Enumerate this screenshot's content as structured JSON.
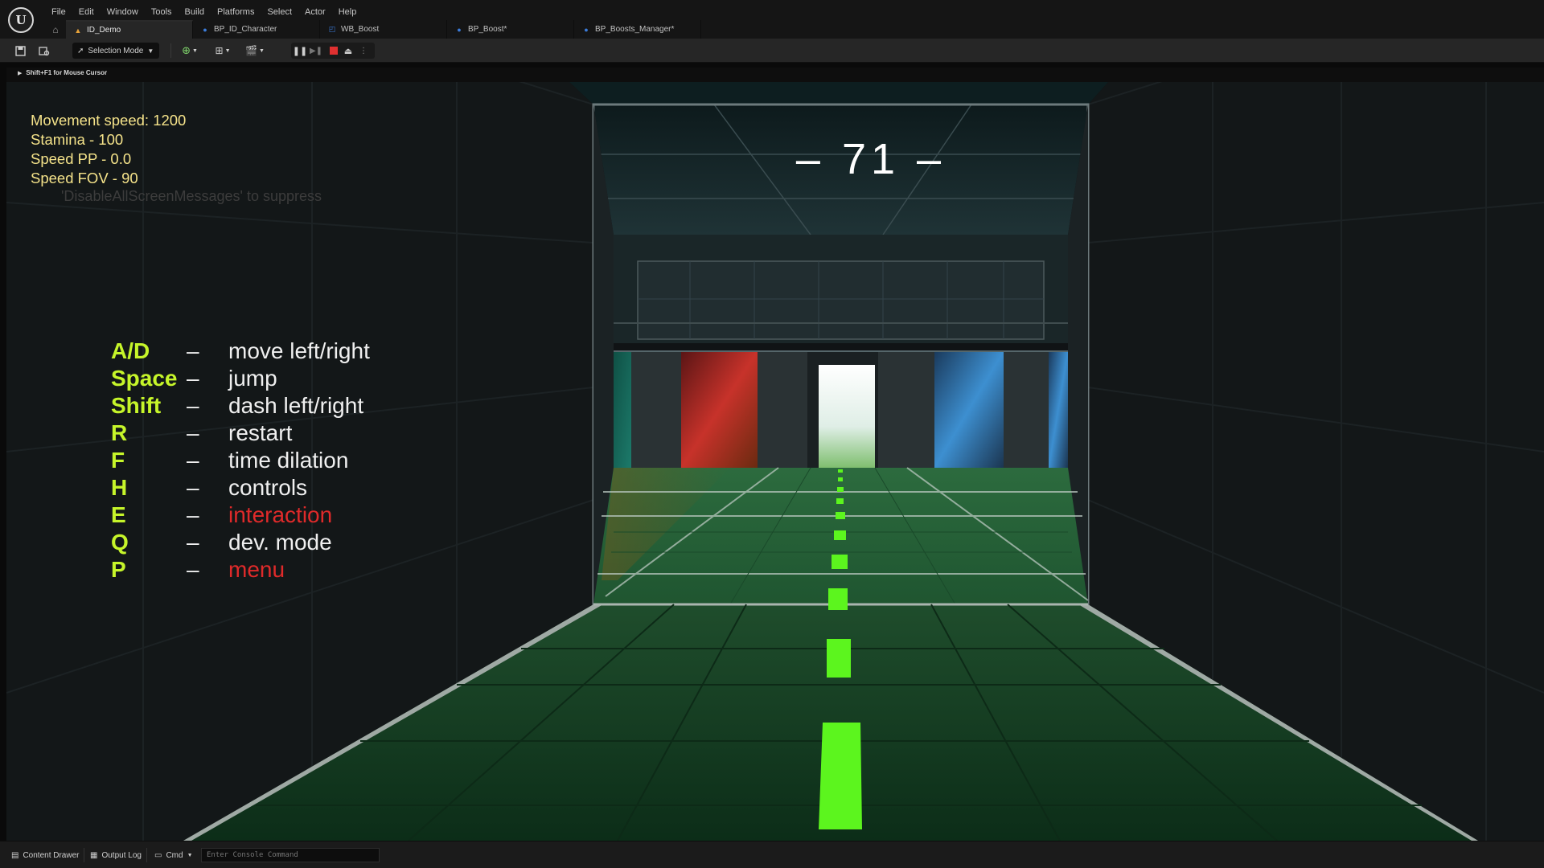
{
  "menu": [
    "File",
    "Edit",
    "Window",
    "Tools",
    "Build",
    "Platforms",
    "Select",
    "Actor",
    "Help"
  ],
  "tabs": [
    {
      "label": "ID_Demo",
      "icon": "level-icon",
      "active": true
    },
    {
      "label": "BP_ID_Character",
      "icon": "blueprint-icon",
      "active": false
    },
    {
      "label": "WB_Boost",
      "icon": "widget-blueprint-icon",
      "active": false
    },
    {
      "label": "BP_Boost*",
      "icon": "blueprint-icon",
      "active": false
    },
    {
      "label": "BP_Boosts_Manager*",
      "icon": "blueprint-icon",
      "active": false
    }
  ],
  "toolbar": {
    "selection_mode": "Selection Mode"
  },
  "viewport": {
    "hint": "Shift+F1 for Mouse Cursor"
  },
  "hud": {
    "stats": [
      "Movement speed: 1200",
      "Stamina - 100",
      "Speed PP - 0.0",
      "Speed FOV - 90"
    ],
    "suppress_msg": "'DisableAllScreenMessages' to suppress",
    "counter": "– 71 –",
    "controls": [
      {
        "key": "A/D",
        "dash": "–",
        "desc": "move left/right",
        "highlight": false
      },
      {
        "key": "Space",
        "dash": "–",
        "desc": "jump",
        "highlight": false
      },
      {
        "key": "Shift",
        "dash": "–",
        "desc": "dash left/right",
        "highlight": false
      },
      {
        "key": "R",
        "dash": "–",
        "desc": "restart",
        "highlight": false
      },
      {
        "key": "F",
        "dash": "–",
        "desc": "time dilation",
        "highlight": false
      },
      {
        "key": "H",
        "dash": "–",
        "desc": "controls",
        "highlight": false
      },
      {
        "key": "E",
        "dash": "–",
        "desc": "interaction",
        "highlight": true
      },
      {
        "key": "Q",
        "dash": "–",
        "desc": "dev. mode",
        "highlight": false
      },
      {
        "key": "P",
        "dash": "–",
        "desc": "menu",
        "highlight": true
      }
    ],
    "colors": {
      "key": "#c6f52a",
      "stats": "#f5e38a",
      "highlight": "#e02a2a",
      "lane_marks": "#5cf51e"
    }
  },
  "statusbar": {
    "content_drawer": "Content Drawer",
    "output_log": "Output Log",
    "cmd": "Cmd",
    "console_placeholder": "Enter Console Command"
  }
}
